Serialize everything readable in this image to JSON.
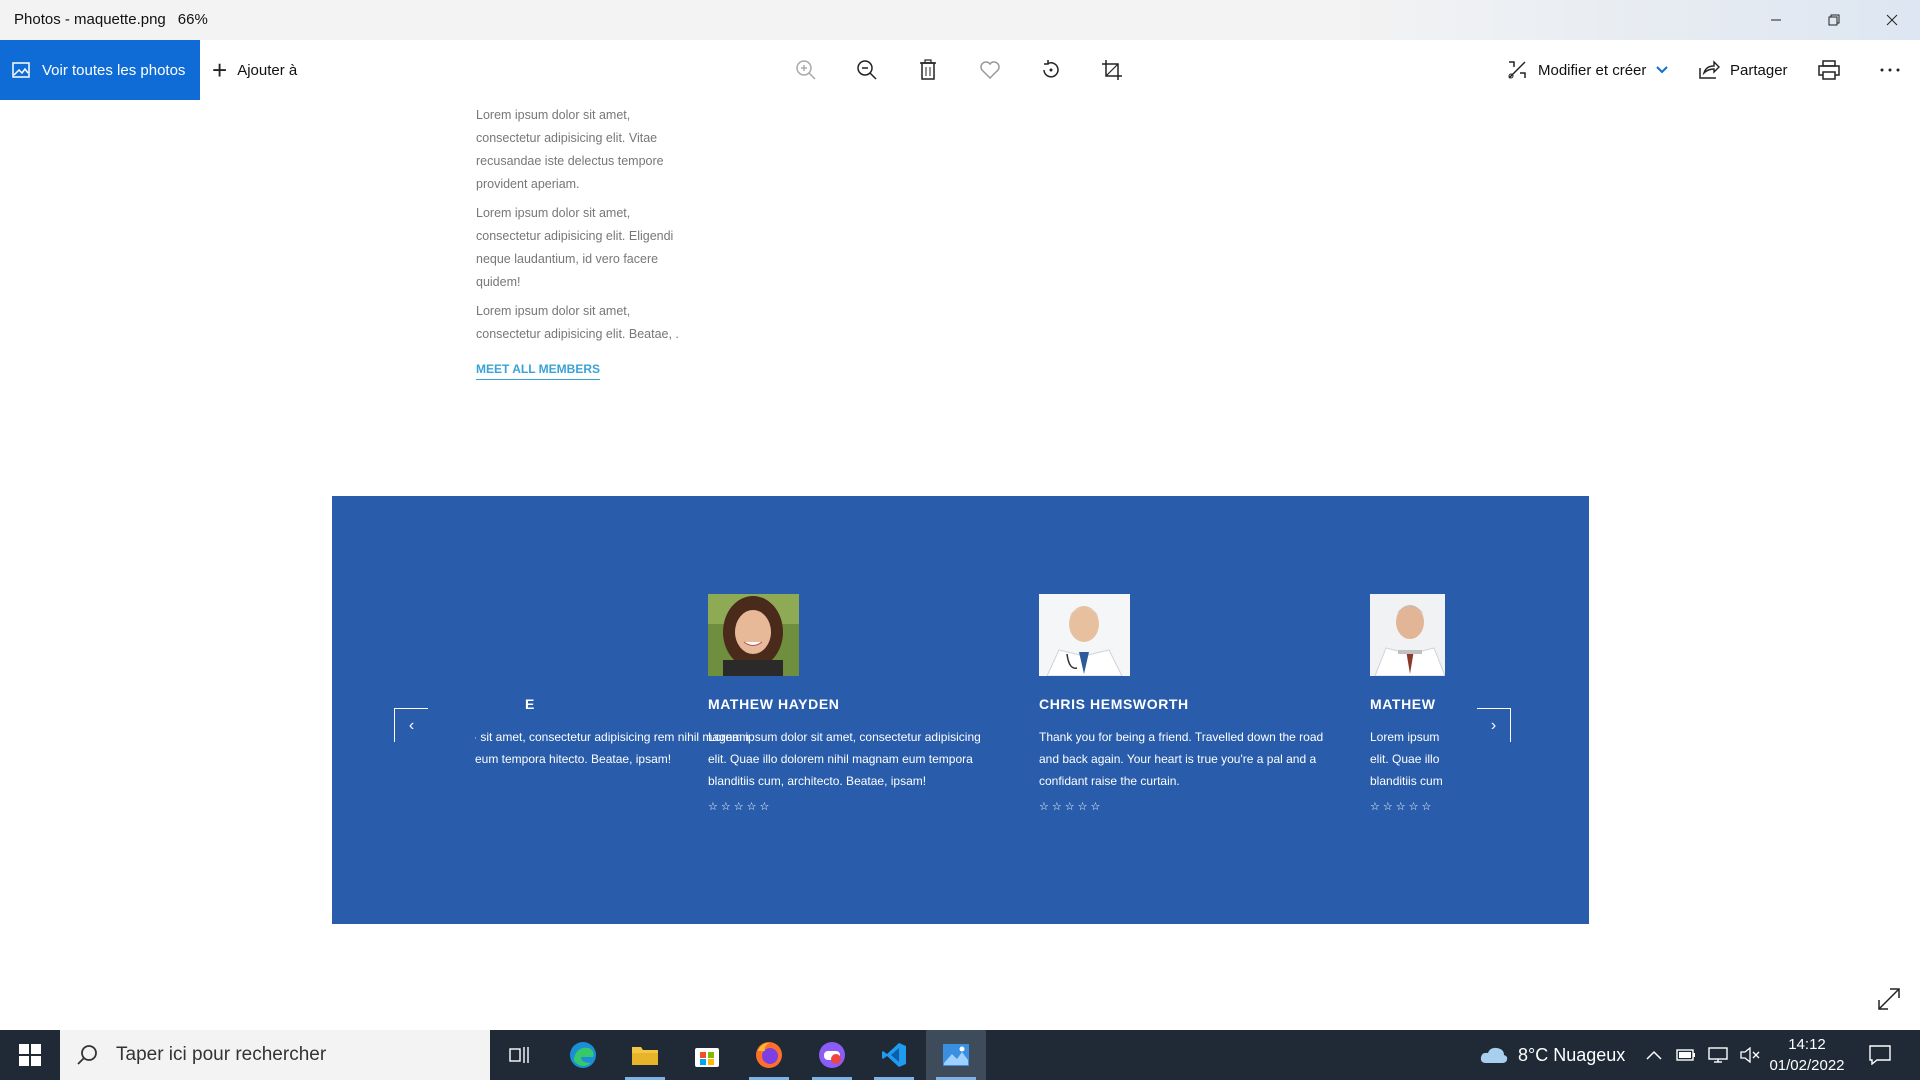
{
  "window": {
    "title": "Photos - maquette.png",
    "zoom": "66%"
  },
  "toolbar": {
    "view_all": "Voir toutes les photos",
    "add_to": "Ajouter à",
    "edit_create": "Modifier et créer",
    "share": "Partager"
  },
  "page": {
    "paragraphs": [
      "Lorem ipsum dolor sit amet, consectetur adipisicing elit. Vitae recusandae iste delectus tempore provident aperiam.",
      "Lorem ipsum dolor sit amet, consectetur adipisicing elit. Eligendi neque laudantium, id vero facere quidem!",
      "Lorem ipsum dolor sit amet, consectetur adipisicing elit. Beatae, ."
    ],
    "meet_link": "MEET ALL MEMBERS"
  },
  "testimonials": {
    "prev": "‹",
    "next": "›",
    "cards": [
      {
        "name": "E",
        "text": "· sit amet, consectetur adipisicing rem nihil magnam eum tempora hitecto. Beatae, ipsam!",
        "stars": "☆☆☆☆☆"
      },
      {
        "name": "MATHEW HAYDEN",
        "text": "Lorem ipsum dolor sit amet, consectetur adipisicing elit. Quae illo dolorem nihil magnam eum tempora blanditiis cum, architecto. Beatae, ipsam!",
        "stars": "☆☆☆☆☆"
      },
      {
        "name": "CHRIS HEMSWORTH",
        "text": "Thank you for being a friend. Travelled down the road and back again. Your heart is true you're a pal and a confidant raise the curtain.",
        "stars": "☆☆☆☆☆"
      },
      {
        "name": "MATHEW",
        "text": "Lorem ipsum elit. Quae illo blanditiis cum",
        "stars": "☆☆☆☆☆"
      }
    ]
  },
  "taskbar": {
    "search_placeholder": "Taper ici pour rechercher",
    "weather": "8°C  Nuageux",
    "time": "14:12",
    "date": "01/02/2022"
  },
  "colors": {
    "accent": "#0f6cd6",
    "panel_blue": "#295dab",
    "link": "#3aa3d6"
  }
}
